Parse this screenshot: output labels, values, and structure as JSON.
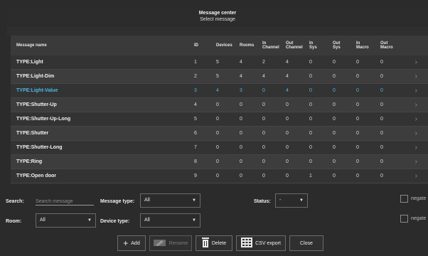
{
  "header": {
    "title": "Message center",
    "subtitle": "Select message"
  },
  "table": {
    "columns": {
      "name": "Message name",
      "id": "ID",
      "devices": "Devices",
      "rooms": "Rooms",
      "in_channel_1": "In",
      "in_channel_2": "Channel",
      "out_channel_1": "Out",
      "out_channel_2": "Channel",
      "in_sys_1": "In",
      "in_sys_2": "Sys",
      "out_sys_1": "Out",
      "out_sys_2": "Sys",
      "in_macro_1": "In",
      "in_macro_2": "Macro",
      "out_macro_1": "Out",
      "out_macro_2": "Macro"
    },
    "rows": [
      {
        "name": "TYPE:Light",
        "id": "1",
        "devices": "5",
        "rooms": "4",
        "in_ch": "2",
        "out_ch": "4",
        "in_sys": "0",
        "out_sys": "0",
        "in_mac": "0",
        "out_mac": "0"
      },
      {
        "name": "TYPE:Light-Dim",
        "id": "2",
        "devices": "5",
        "rooms": "4",
        "in_ch": "4",
        "out_ch": "4",
        "in_sys": "0",
        "out_sys": "0",
        "in_mac": "0",
        "out_mac": "0"
      },
      {
        "name": "TYPE:Light-Value",
        "id": "3",
        "devices": "4",
        "rooms": "3",
        "in_ch": "0",
        "out_ch": "4",
        "in_sys": "0",
        "out_sys": "0",
        "in_mac": "0",
        "out_mac": "0"
      },
      {
        "name": "TYPE:Shutter-Up",
        "id": "4",
        "devices": "0",
        "rooms": "0",
        "in_ch": "0",
        "out_ch": "0",
        "in_sys": "0",
        "out_sys": "0",
        "in_mac": "0",
        "out_mac": "0"
      },
      {
        "name": "TYPE:Shutter-Up-Long",
        "id": "5",
        "devices": "0",
        "rooms": "0",
        "in_ch": "0",
        "out_ch": "0",
        "in_sys": "0",
        "out_sys": "0",
        "in_mac": "0",
        "out_mac": "0"
      },
      {
        "name": "TYPE:Shutter",
        "id": "6",
        "devices": "0",
        "rooms": "0",
        "in_ch": "0",
        "out_ch": "0",
        "in_sys": "0",
        "out_sys": "0",
        "in_mac": "0",
        "out_mac": "0"
      },
      {
        "name": "TYPE:Shutter-Long",
        "id": "7",
        "devices": "0",
        "rooms": "0",
        "in_ch": "0",
        "out_ch": "0",
        "in_sys": "0",
        "out_sys": "0",
        "in_mac": "0",
        "out_mac": "0"
      },
      {
        "name": "TYPE:Ring",
        "id": "8",
        "devices": "0",
        "rooms": "0",
        "in_ch": "0",
        "out_ch": "0",
        "in_sys": "0",
        "out_sys": "0",
        "in_mac": "0",
        "out_mac": "0"
      },
      {
        "name": "TYPE:Open door",
        "id": "9",
        "devices": "0",
        "rooms": "0",
        "in_ch": "0",
        "out_ch": "0",
        "in_sys": "1",
        "out_sys": "0",
        "in_mac": "0",
        "out_mac": "0"
      }
    ],
    "selected_index": 2,
    "arrow_icon": "chevron-right-icon"
  },
  "filters": {
    "search_label": "Search:",
    "search_placeholder": "Search message",
    "message_type_label": "Message type:",
    "message_type_value": "All",
    "status_label": "Status:",
    "status_value": "-",
    "room_label": "Room:",
    "room_value": "All",
    "device_type_label": "Device type:",
    "device_type_value": "All",
    "negate_1": "negate",
    "negate_2": "negate"
  },
  "toolbar": {
    "add": "Add",
    "rename": "Rename",
    "delete": "Delete",
    "csv_export": "CSV export",
    "close": "Close"
  },
  "colors": {
    "accent": "#4fb6e6",
    "background": "#2b2b2b"
  }
}
